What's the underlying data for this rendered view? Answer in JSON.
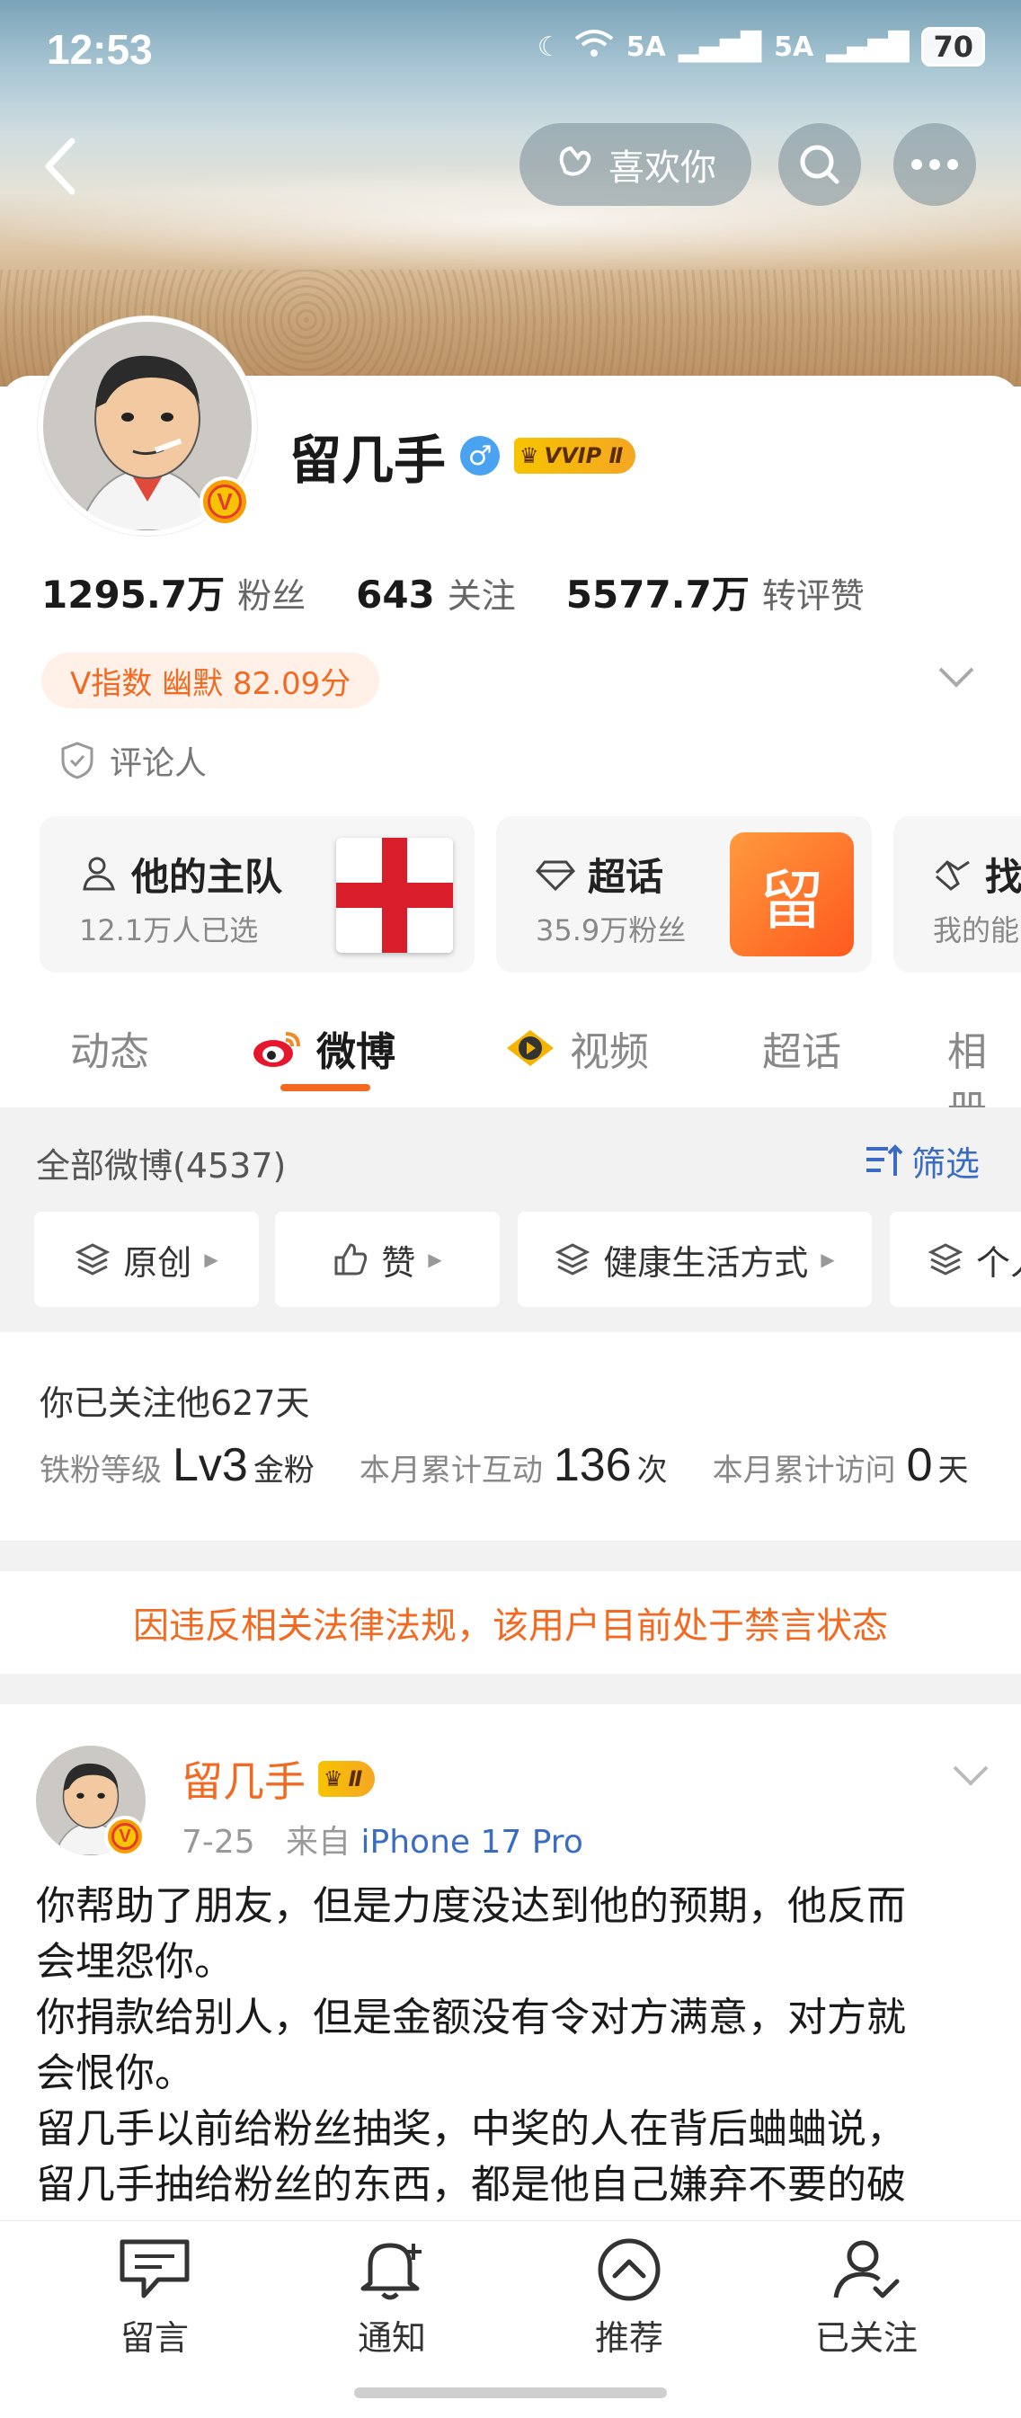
{
  "status_bar": {
    "time": "12:53",
    "signal1": "5A",
    "signal2": "5A",
    "battery": "70"
  },
  "nav": {
    "like_button": "喜欢你"
  },
  "profile": {
    "name": "留几手",
    "vvip_label": "VVIP Ⅱ",
    "fans_count": "1295.7万",
    "fans_label": "粉丝",
    "following_count": "643",
    "following_label": "关注",
    "interactions_count": "5577.7万",
    "interactions_label": "转评赞",
    "v_index": "V指数 幽默 82.09分",
    "role": "评论人"
  },
  "feature_cards": [
    {
      "title": "他的主队",
      "subtitle": "12.1万人已选"
    },
    {
      "title": "超话",
      "subtitle": "35.9万粉丝",
      "badge_char": "留"
    },
    {
      "title": "找",
      "subtitle": "我的能"
    }
  ],
  "tabs": [
    "动态",
    "微博",
    "视频",
    "超话",
    "相册"
  ],
  "active_tab": "微博",
  "filter_bar": {
    "all_label": "全部微博(4537)",
    "filter_label": "筛选"
  },
  "chips": [
    "原创",
    "赞",
    "健康生活方式",
    "个人"
  ],
  "fan_info": {
    "followed_text": "你已关注他627天",
    "level_label": "铁粉等级",
    "level_value": "Lv3",
    "level_unit": "金粉",
    "interact_label": "本月累计互动",
    "interact_value": "136",
    "interact_unit": "次",
    "visit_label": "本月累计访问",
    "visit_value": "0",
    "visit_unit": "天"
  },
  "ban_notice": "因违反相关法律法规，该用户目前处于禁言状态",
  "post": {
    "author": "留几手",
    "vip_label": "Ⅱ",
    "date": "7-25",
    "source_prefix": "来自",
    "device": "iPhone 17 Pro",
    "body_lines": [
      "你帮助了朋友，但是力度没达到他的预期，他反而",
      "会埋怨你。",
      "你捐款给别人，但是金额没有令对方满意，对方就",
      "会恨你。",
      "留几手以前给粉丝抽奖，中奖的人在背后蛐蛐说，",
      "留几手抽给粉丝的东西，都是他自己嫌弃不要的破"
    ]
  },
  "bottom_nav": [
    "留言",
    "通知",
    "推荐",
    "已关注"
  ],
  "colors": {
    "accent": "#f26a21",
    "link": "#3b6cc4",
    "vip_gold": "#f5a623"
  }
}
